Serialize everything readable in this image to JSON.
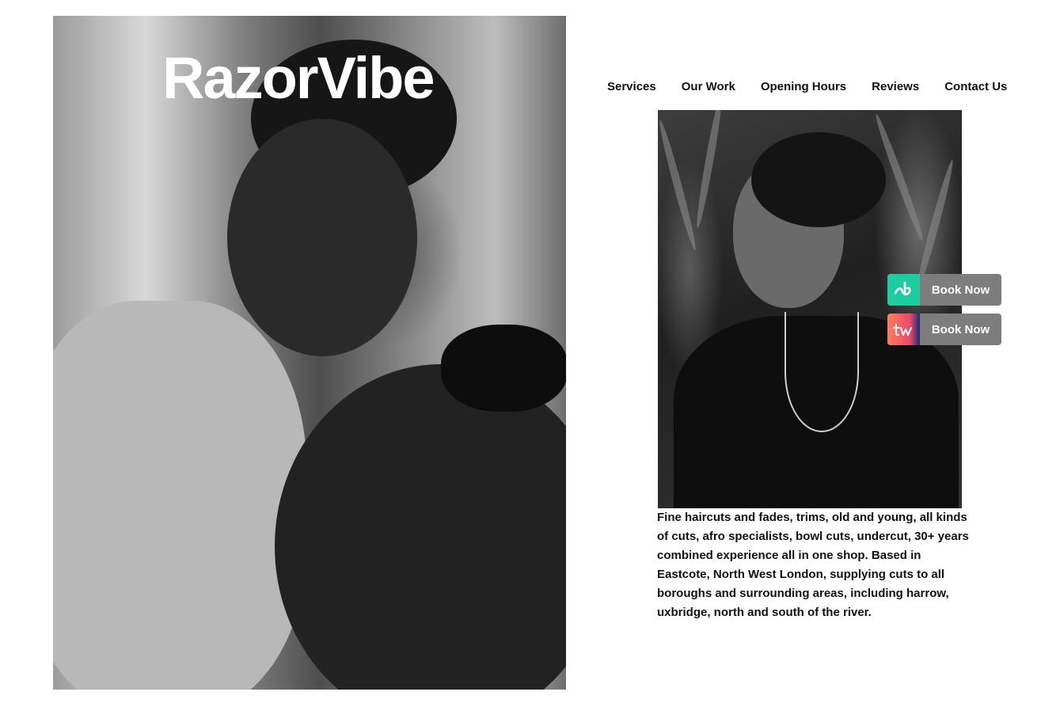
{
  "brand": {
    "name": "RazorVibe"
  },
  "nav": {
    "items": [
      {
        "label": "Services"
      },
      {
        "label": "Our Work"
      },
      {
        "label": "Opening Hours"
      },
      {
        "label": "Reviews"
      },
      {
        "label": "Contact Us"
      }
    ]
  },
  "booking": {
    "buttons": [
      {
        "provider_icon": "booksy-logo-icon",
        "label": "Book Now",
        "accent": "#1fcba0"
      },
      {
        "provider_icon": "treatwell-logo-icon",
        "label": "Book Now",
        "accent": "#e84a6a"
      }
    ]
  },
  "about": {
    "text": "Fine haircuts and fades, trims, old and young, all kinds of cuts, afro specialists, bowl cuts, undercut, 30+ years combined experience all in one shop. Based in Eastcote, North West London, supplying cuts to all boroughs and surrounding areas, including harrow, uxbridge, north and south of the river."
  },
  "images": {
    "hero": "barber-cutting-hair-photo",
    "portrait": "client-portrait-photo"
  }
}
